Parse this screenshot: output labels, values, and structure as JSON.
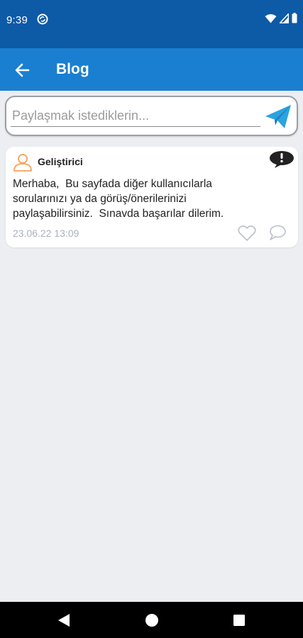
{
  "status_bar": {
    "time": "9:39",
    "icons": [
      "sync-icon",
      "wifi-icon",
      "signal-icon",
      "battery-icon"
    ]
  },
  "app_bar": {
    "title": "Blog",
    "back_icon": "arrow-left-icon",
    "background": "#1a7fd0"
  },
  "composer": {
    "placeholder": "Paylaşmak istediklerin...",
    "value": "",
    "send_icon": "paper-plane-icon",
    "send_color": "#2aa3e0"
  },
  "posts": [
    {
      "author": "Geliştirici",
      "avatar_icon": "user-outline-icon",
      "body": "Merhaba,  Bu sayfada diğer kullanıcılarla\nsorularınızı ya da görüş/önerilerinizi\npaylaşabilirsiniz.  Sınavda başarılar dilerim.",
      "timestamp": "23.06.22 13:09",
      "report_icon": "exclamation-bubble-icon",
      "like_icon": "heart-outline-icon",
      "comment_icon": "comment-outline-icon"
    }
  ],
  "nav_bar": {
    "icons": [
      "nav-back-icon",
      "nav-home-icon",
      "nav-recents-icon"
    ]
  }
}
